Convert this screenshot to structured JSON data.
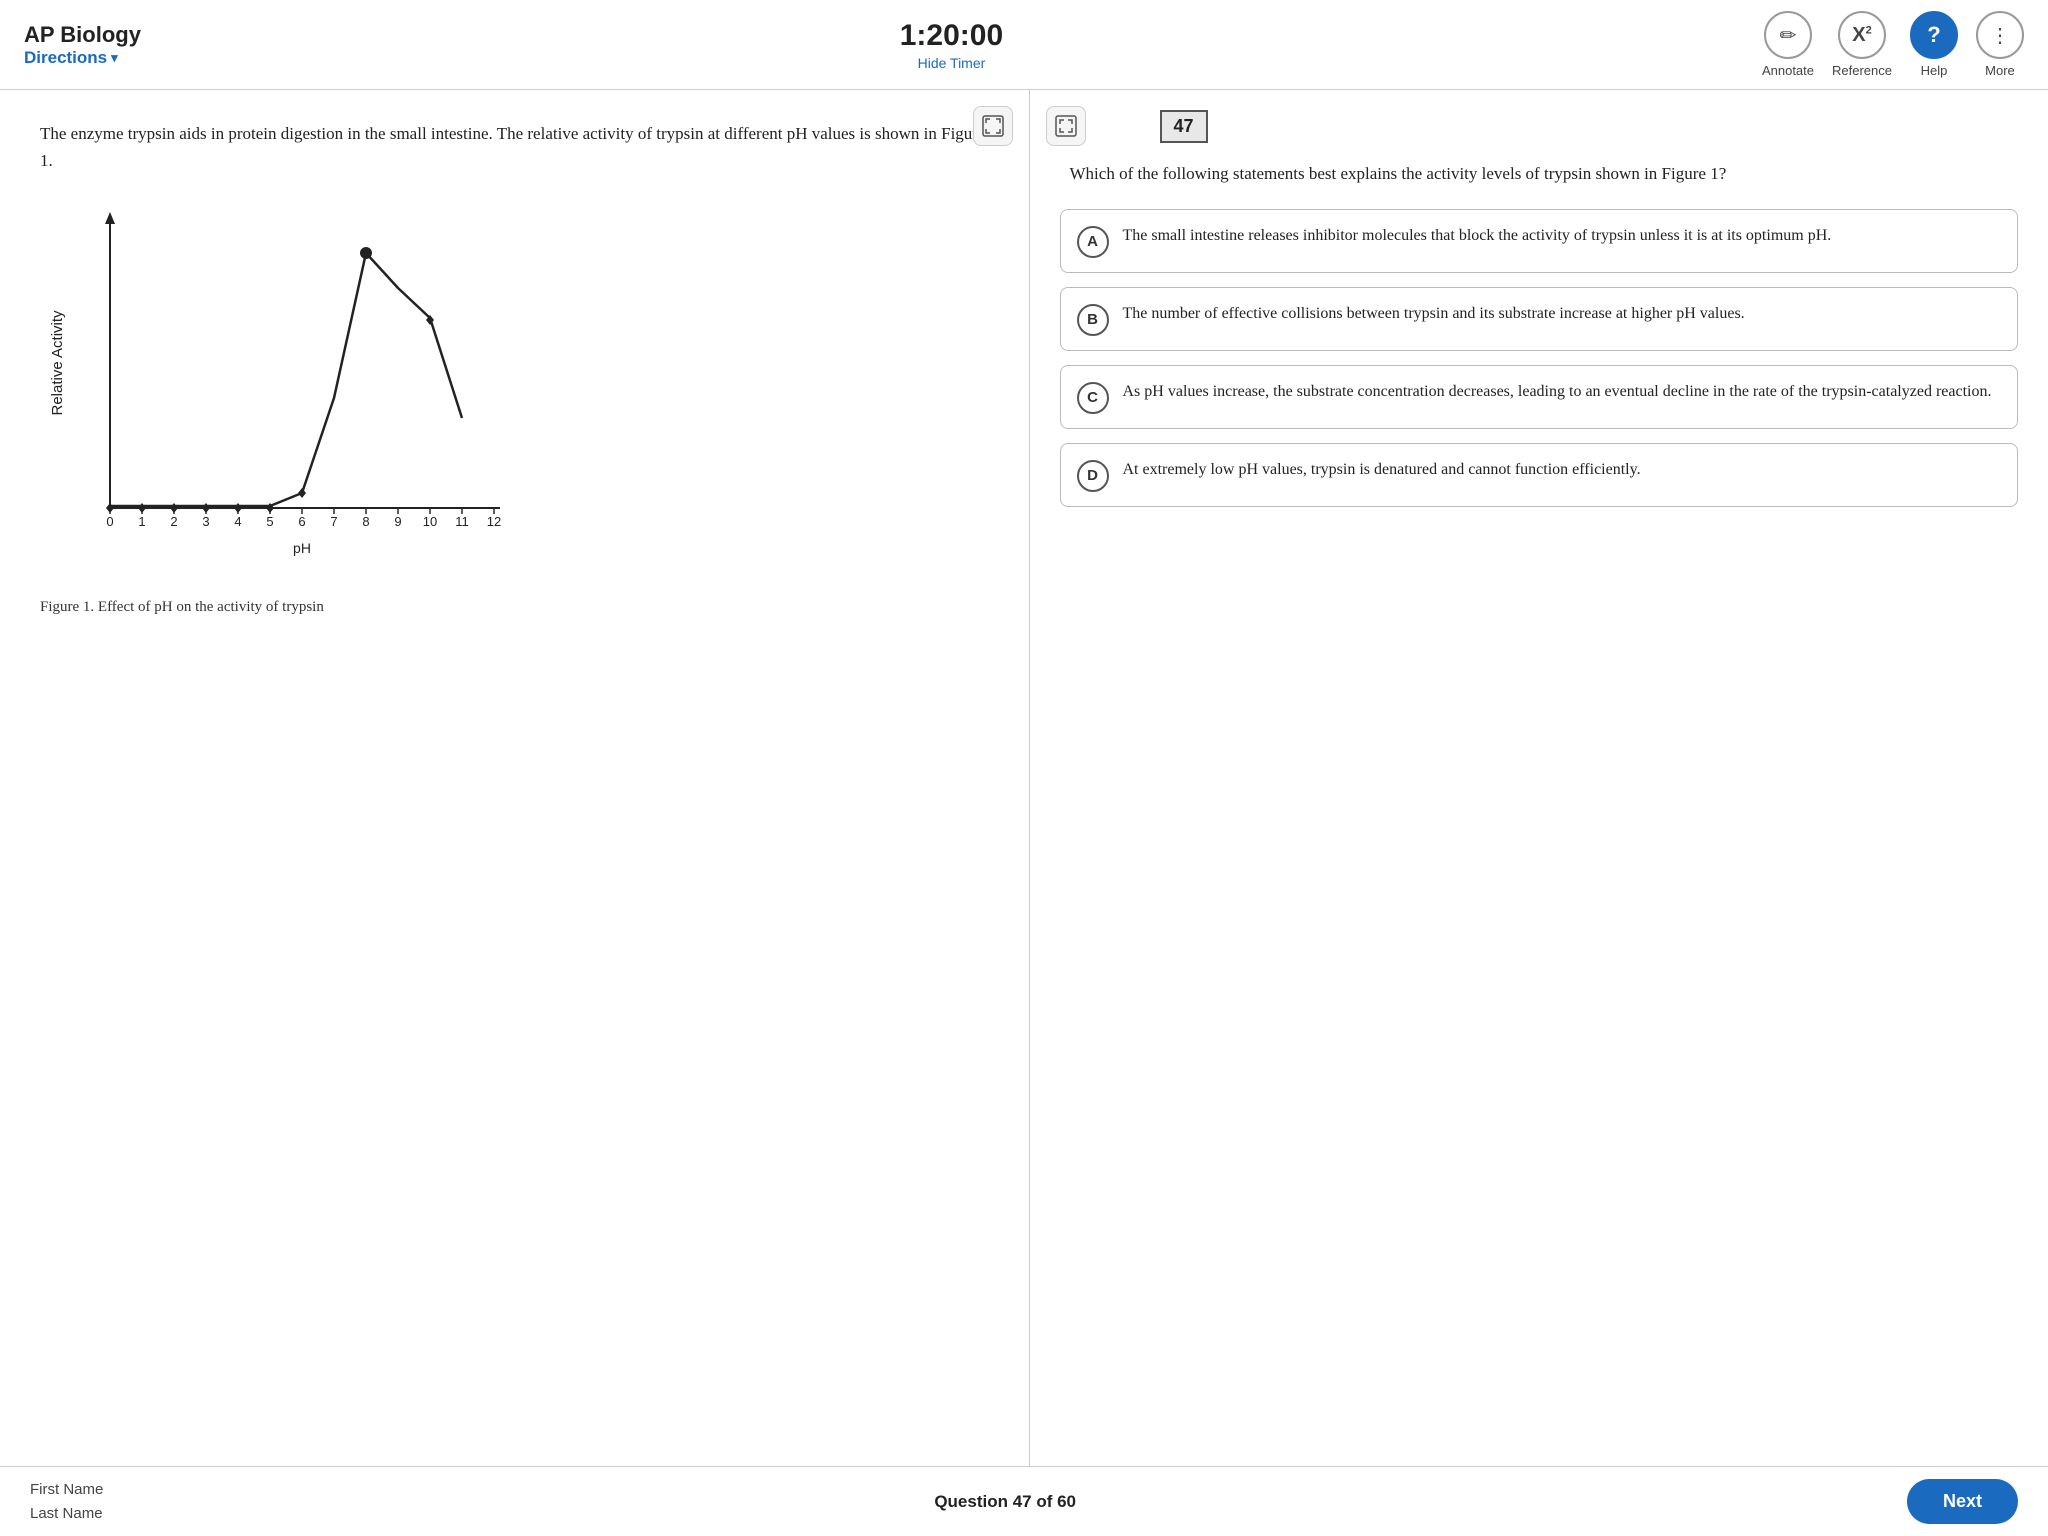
{
  "header": {
    "app_title": "AP Biology",
    "directions_label": "Directions",
    "timer": "1:20:00",
    "hide_timer_label": "Hide Timer",
    "annotate_label": "Annotate",
    "reference_label": "Reference",
    "help_label": "Help",
    "more_label": "More"
  },
  "left_panel": {
    "passage": "The enzyme trypsin aids in protein digestion in the small intestine. The relative activity of trypsin at different pH values is shown in Figure 1.",
    "figure_caption": "Figure 1. Effect of pH on the activity of trypsin",
    "chart": {
      "x_label": "pH",
      "y_label": "Relative Activity",
      "x_ticks": [
        "0",
        "1",
        "2",
        "3",
        "4",
        "5",
        "6",
        "7",
        "8",
        "9",
        "10",
        "11",
        "12"
      ]
    }
  },
  "right_panel": {
    "question_number": "47",
    "question_text": "Which of the following statements best explains the activity levels of trypsin shown in Figure 1?",
    "choices": [
      {
        "letter": "A",
        "text": "The small intestine releases inhibitor molecules that block the activity of trypsin unless it is at its optimum pH."
      },
      {
        "letter": "B",
        "text": "The number of effective collisions between trypsin and its substrate increase at higher pH values."
      },
      {
        "letter": "C",
        "text": "As pH values increase, the substrate concentration decreases, leading to an eventual decline in the rate of the trypsin-catalyzed reaction."
      },
      {
        "letter": "D",
        "text": "At extremely low pH values, trypsin is denatured and cannot function efficiently."
      }
    ]
  },
  "footer": {
    "user_name_line1": "First Name",
    "user_name_line2": "Last Name",
    "question_progress": "Question 47 of 60",
    "next_label": "Next"
  },
  "icons": {
    "annotate": "✏",
    "reference": "X²",
    "help": "?",
    "more": "⋮",
    "expand": "⛶",
    "collapse": "⛶"
  }
}
